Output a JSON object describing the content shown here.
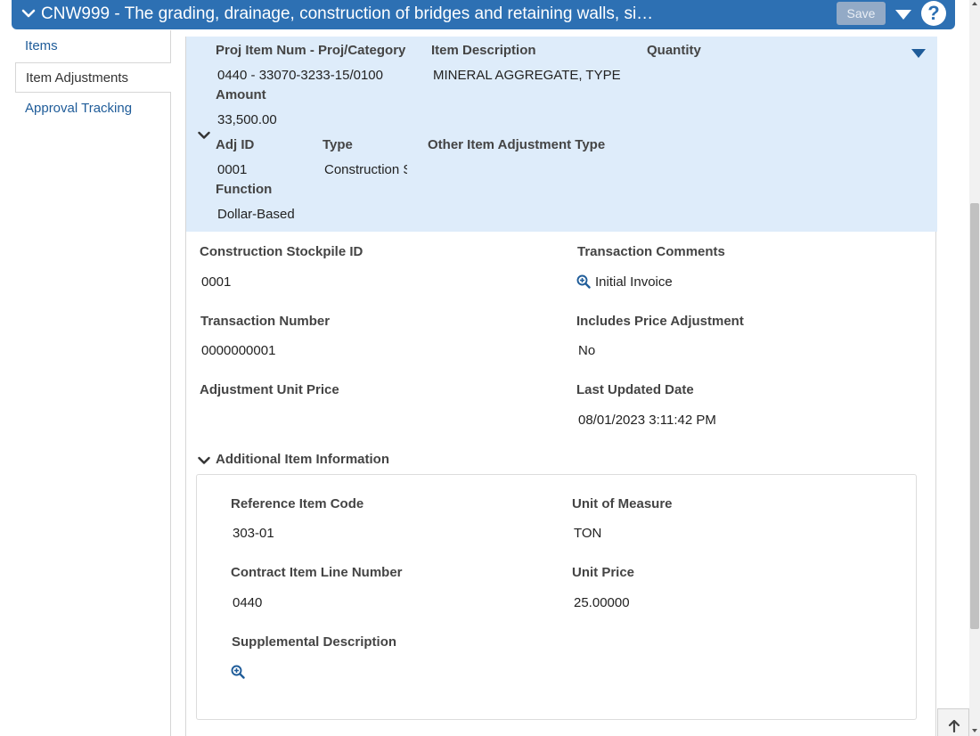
{
  "header": {
    "title": "CNW999 - The grading, drainage, construction of bridges and retaining walls, si…",
    "save_label": "Save",
    "help_label": "?"
  },
  "sidebar": {
    "items": [
      {
        "label": "Items"
      },
      {
        "label": "Item Adjustments"
      },
      {
        "label": "Approval Tracking"
      }
    ]
  },
  "summary": {
    "proj_item_num_label": "Proj Item Num - Proj/Category",
    "proj_item_num_value": "0440 - 33070-3233-15/0100",
    "item_description_label": "Item Description",
    "item_description_value": "MINERAL AGGREGATE, TYPE",
    "quantity_label": "Quantity",
    "amount_label": "Amount",
    "amount_value": "33,500.00",
    "adj_id_label": "Adj ID",
    "adj_id_value": "0001",
    "type_label": "Type",
    "type_value": "Construction Stockpile",
    "other_type_label": "Other Item Adjustment Type",
    "function_label": "Function",
    "function_value": "Dollar-Based"
  },
  "details": {
    "stockpile_id_label": "Construction Stockpile ID",
    "stockpile_id_value": "0001",
    "transaction_comments_label": "Transaction Comments",
    "transaction_comments_value": "Initial Invoice",
    "transaction_number_label": "Transaction Number",
    "transaction_number_value": "0000000001",
    "includes_price_adj_label": "Includes Price Adjustment",
    "includes_price_adj_value": "No",
    "adj_unit_price_label": "Adjustment Unit Price",
    "last_updated_label": "Last Updated Date",
    "last_updated_value": "08/01/2023 3:11:42 PM"
  },
  "additional": {
    "section_label": "Additional Item Information",
    "ref_item_code_label": "Reference Item Code",
    "ref_item_code_value": "303-01",
    "unit_of_measure_label": "Unit of Measure",
    "unit_of_measure_value": "TON",
    "contract_line_label": "Contract Item Line Number",
    "contract_line_value": "0440",
    "unit_price_label": "Unit Price",
    "unit_price_value": "25.00000",
    "supplemental_label": "Supplemental Description"
  },
  "icons": {
    "accent": "#2d70b3",
    "link": "#1f5c99"
  }
}
